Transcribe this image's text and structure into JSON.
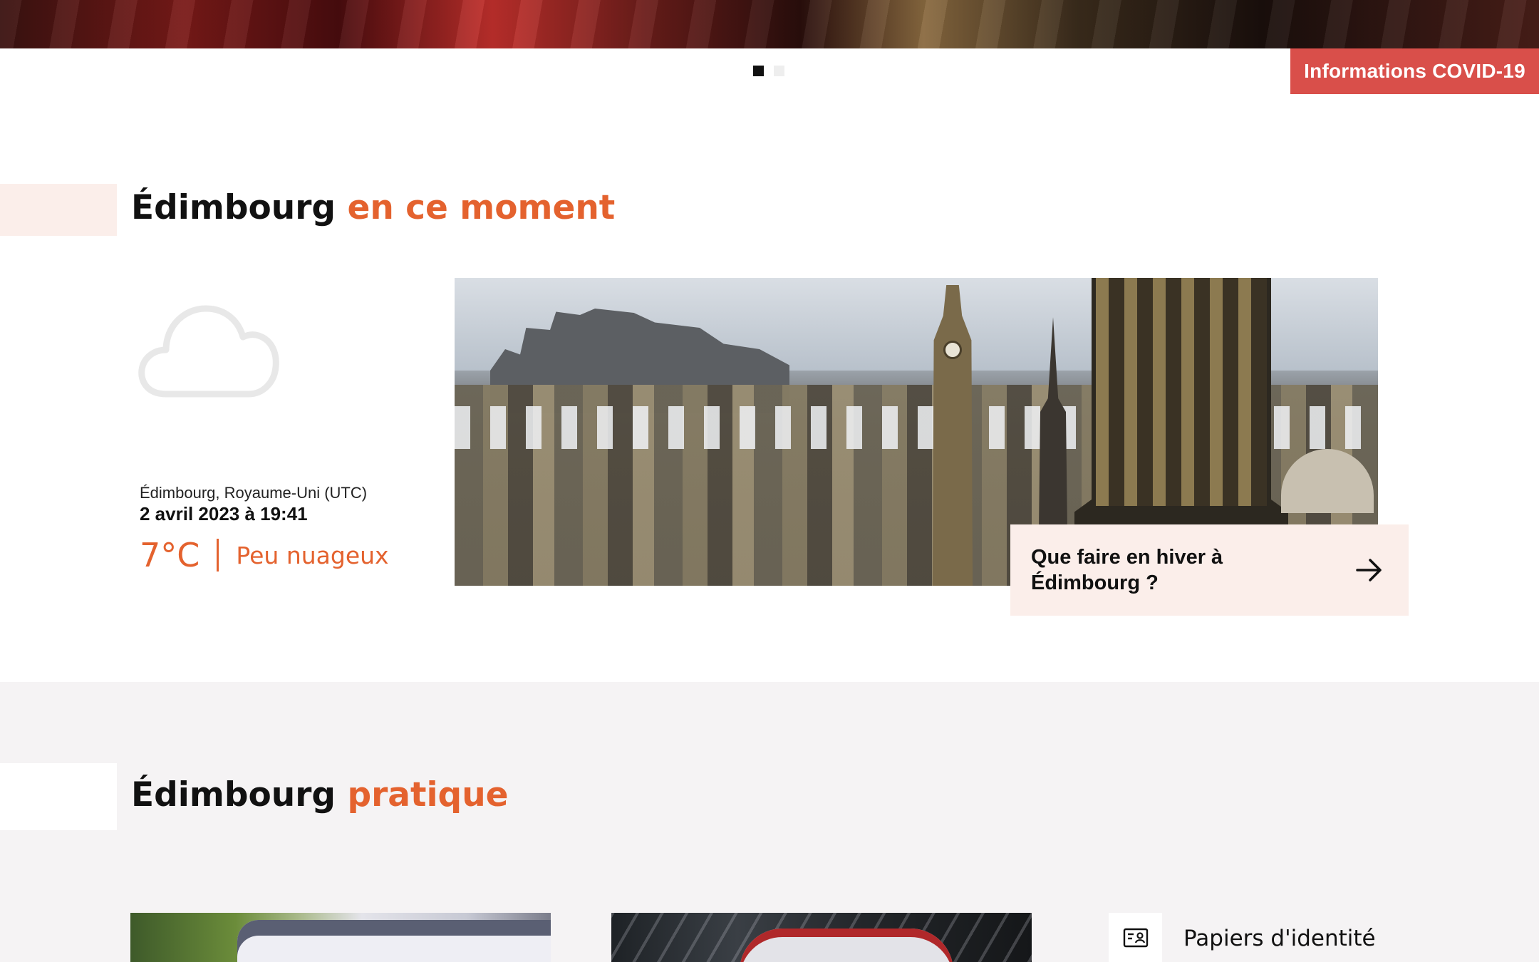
{
  "hero": {
    "slides": 2,
    "active_slide": 1
  },
  "covid": {
    "label": "Informations COVID-19",
    "color": "#d94f4a"
  },
  "now_section": {
    "title_main": "Édimbourg",
    "title_accent": "en ce moment",
    "accent_color": "#e4622e"
  },
  "weather": {
    "icon": "cloud-icon",
    "location": "Édimbourg, Royaume-Uni (UTC)",
    "datetime": "2 avril 2023 à 19:41",
    "temperature": "7°C",
    "condition": "Peu nuageux"
  },
  "feature_card": {
    "title": "Que faire en hiver à Édimbourg ?",
    "icon": "arrow-right-icon"
  },
  "practical_section": {
    "title_main": "Édimbourg",
    "title_accent": "pratique"
  },
  "practical_links": [
    {
      "label": "Papiers d'identité",
      "icon": "id-card-icon"
    }
  ]
}
